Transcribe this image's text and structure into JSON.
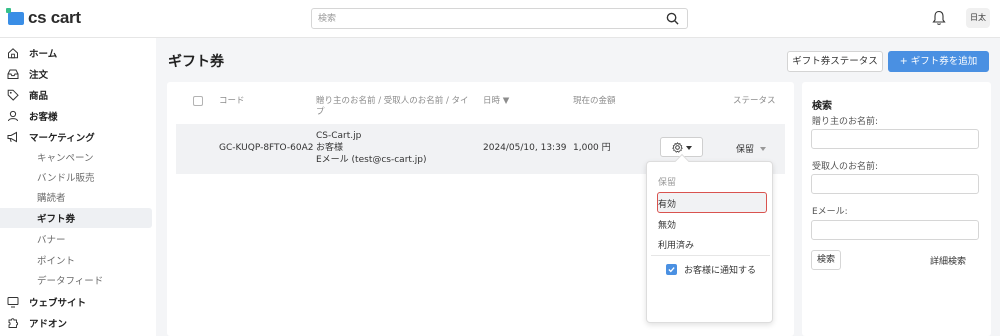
{
  "header": {
    "logo_text": "cs cart",
    "search_placeholder": "検索",
    "lang_label": "日太"
  },
  "sidebar": {
    "items": [
      {
        "label": "ホーム",
        "icon": "home-icon"
      },
      {
        "label": "注文",
        "icon": "inbox-icon"
      },
      {
        "label": "商品",
        "icon": "tag-icon"
      },
      {
        "label": "お客様",
        "icon": "user-icon"
      },
      {
        "label": "マーケティング",
        "icon": "megaphone-icon"
      }
    ],
    "sub_items": [
      {
        "label": "キャンペーン",
        "active": false
      },
      {
        "label": "バンドル販売",
        "active": false
      },
      {
        "label": "購読者",
        "active": false
      },
      {
        "label": "ギフト券",
        "active": true
      },
      {
        "label": "バナー",
        "active": false
      },
      {
        "label": "ポイント",
        "active": false
      },
      {
        "label": "データフィード",
        "active": false
      }
    ],
    "bottom_items": [
      {
        "label": "ウェブサイト",
        "icon": "monitor-icon"
      },
      {
        "label": "アドオン",
        "icon": "puzzle-icon"
      }
    ]
  },
  "page": {
    "title": "ギフト券",
    "status_button": "ギフト券ステータス",
    "add_button": "+ ギフト券を追加"
  },
  "table": {
    "headers": {
      "code": "コード",
      "names_line1": "贈り主のお名前 / 受取人のお名前 / タイ",
      "names_line2": "プ",
      "date": "日時 ▼",
      "amount": "現在の金額",
      "status": "ステータス"
    },
    "rows": [
      {
        "code": "GC-KUQP-8FTO-60A2",
        "sender": "CS-Cart.jp",
        "recipient": "お客様",
        "type": "Eメール (test@cs-cart.jp)",
        "date": "2024/05/10, 13:39",
        "amount": "1,000 円",
        "status": "保留"
      }
    ]
  },
  "status_menu": {
    "header": "保留",
    "options": [
      "有効",
      "無効",
      "利用済み"
    ],
    "selected": "有効",
    "notify_label": "お客様に通知する",
    "notify_checked": true
  },
  "search_panel": {
    "title": "検索",
    "sender_label": "贈り主のお名前:",
    "recipient_label": "受取人のお名前:",
    "email_label": "Eメール:",
    "search_button": "検索",
    "advanced_link": "詳細検索"
  },
  "colors": {
    "accent": "#4a90e2",
    "highlight_border": "#d9534f",
    "background": "#f4f5f7"
  }
}
